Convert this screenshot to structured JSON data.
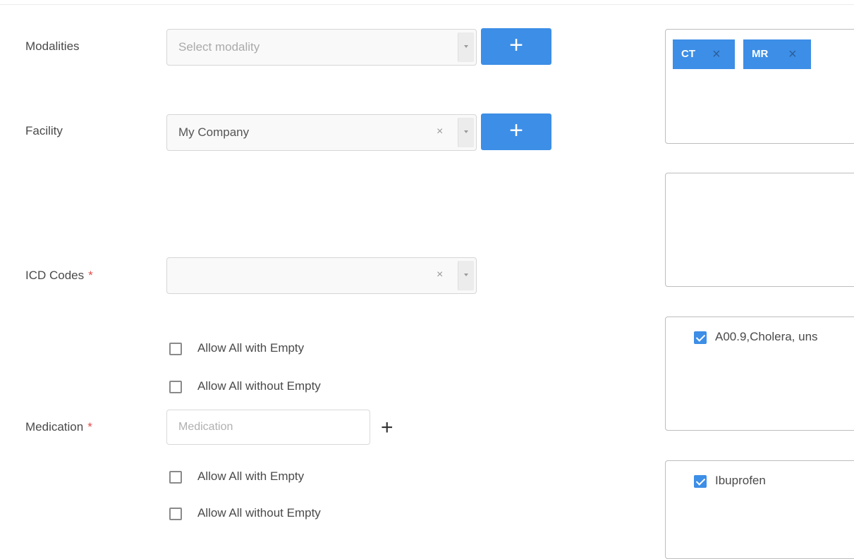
{
  "form": {
    "modalities": {
      "label": "Modalities",
      "placeholder": "Select modality",
      "add_glyph": "+"
    },
    "facility": {
      "label": "Facility",
      "value": "My Company",
      "clear_glyph": "×",
      "add_glyph": "+"
    },
    "icd": {
      "label": "ICD Codes",
      "required_mark": "*",
      "value": "",
      "clear_glyph": "×",
      "allow_with_empty": "Allow All with Empty",
      "allow_without_empty": "Allow All without Empty"
    },
    "medication": {
      "label": "Medication",
      "required_mark": "*",
      "placeholder": "Medication",
      "add_glyph": "+",
      "allow_with_empty": "Allow All with Empty",
      "allow_without_empty": "Allow All without Empty"
    }
  },
  "panels": {
    "modality_chips": [
      {
        "label": "CT",
        "remove": "×"
      },
      {
        "label": "MR",
        "remove": "×"
      }
    ],
    "icd_selected": [
      {
        "label": "A00.9,Cholera, uns",
        "checked": true
      }
    ],
    "medication_selected": [
      {
        "label": "Ibuprofen",
        "checked": true
      }
    ]
  },
  "colors": {
    "accent": "#3d8ee6",
    "required": "#e24b4b"
  },
  "icons": {
    "add": "plus-icon",
    "clear": "close-icon",
    "dropdown": "chevron-down-icon",
    "checkbox": "checkbox-icon"
  }
}
